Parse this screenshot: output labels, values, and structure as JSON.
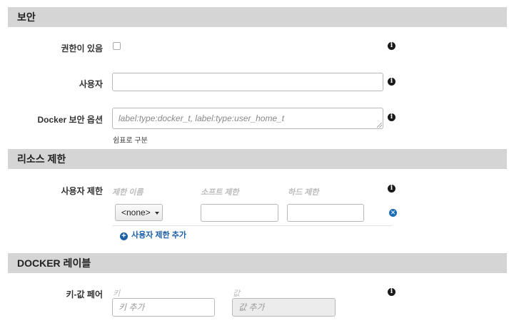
{
  "security": {
    "title": "보안",
    "privileged_label": "권한이 있음",
    "user_label": "사용자",
    "user_value": "",
    "docker_options_label": "Docker 보안 옵션",
    "docker_options_placeholder": "label:type:docker_t, label:type:user_home_t",
    "docker_options_hint": "쉼표로 구분"
  },
  "resource_limits": {
    "title": "리소스 제한",
    "ulimit_label": "사용자 제한",
    "columns": [
      "제한 이름",
      "소프트 제한",
      "하드 제한"
    ],
    "row": {
      "name_select": "<none>",
      "soft": "",
      "hard": ""
    },
    "add_label": "사용자 제한 추가"
  },
  "docker_labels": {
    "title": "DOCKER 레이블",
    "kv_label": "키-값 페어",
    "columns": [
      "키",
      "값"
    ],
    "key_placeholder": "키 추가",
    "value_placeholder": "값 추가"
  },
  "icons": {
    "info": "info-circle-icon",
    "remove": "remove-circle-icon",
    "add": "plus-circle-icon"
  },
  "colors": {
    "header_bg": "#d5d5d5",
    "link": "#1b5fa8"
  }
}
